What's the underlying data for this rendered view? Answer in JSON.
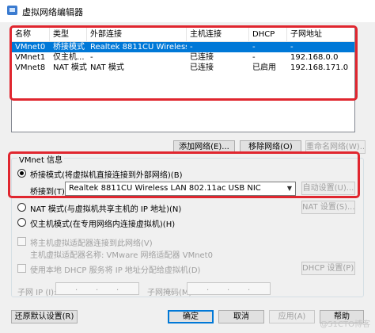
{
  "window": {
    "title": "虚拟网络编辑器"
  },
  "table": {
    "headers": [
      "名称",
      "类型",
      "外部连接",
      "主机连接",
      "DHCP",
      "子网地址"
    ],
    "rows": [
      [
        "VMnet0",
        "桥接模式",
        "Realtek 8811CU Wireless LA...",
        "-",
        "-",
        "-"
      ],
      [
        "VMnet1",
        "仅主机...",
        "-",
        "已连接",
        "-",
        "192.168.0.0"
      ],
      [
        "VMnet8",
        "NAT 模式",
        "NAT 模式",
        "已连接",
        "已启用",
        "192.168.171.0"
      ]
    ],
    "selected_row": 0
  },
  "table_buttons": {
    "add_network": "添加网络(E)...",
    "remove_network": "移除网络(O)",
    "rename_network": "重命名网络(W)..."
  },
  "vmnet_info": {
    "legend": "VMnet 信息",
    "bridged_label": "桥接模式(将虚拟机直接连接到外部网络)(B)",
    "bridged_to_label": "桥接到(T):",
    "bridged_to_value": "Realtek 8811CU Wireless LAN 802.11ac USB NIC",
    "auto_settings": "自动设置(U)...",
    "nat_label": "NAT 模式(与虚拟机共享主机的 IP 地址)(N)",
    "nat_settings": "NAT 设置(S)...",
    "hostonly_label": "仅主机模式(在专用网络内连接虚拟机)(H)",
    "connect_adapter_label": "将主机虚拟适配器连接到此网络(V)",
    "adapter_name_label": "主机虚拟适配器名称: VMware 网络适配器 VMnet0",
    "dhcp_label": "使用本地 DHCP 服务将 IP 地址分配给虚拟机(D)",
    "dhcp_settings": "DHCP 设置(P)...",
    "subnet_ip_label": "子网 IP (I):",
    "subnet_mask_label": "子网掩码(M):"
  },
  "footer": {
    "restore_defaults": "还原默认设置(R)",
    "ok": "确定",
    "cancel": "取消",
    "apply": "应用(A)",
    "help": "帮助"
  },
  "watermark": "@51CTO博客",
  "colors": {
    "selection": "#0078d7",
    "highlight_box": "#e0262f"
  }
}
